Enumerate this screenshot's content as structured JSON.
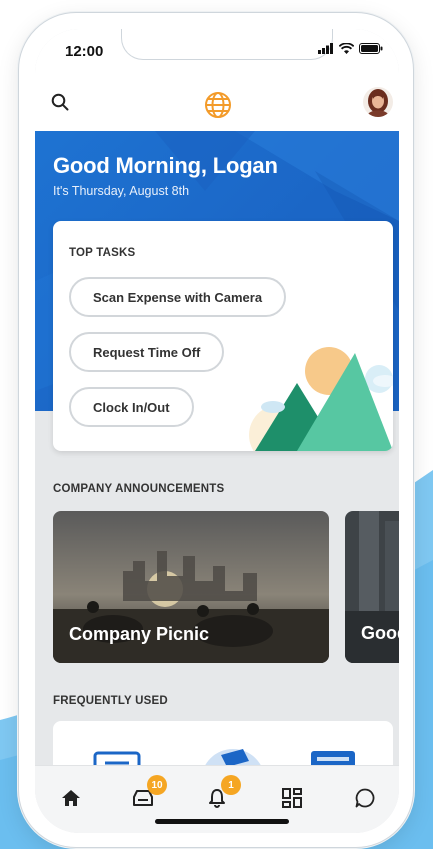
{
  "status_bar": {
    "time": "12:00"
  },
  "app_bar": {
    "search_icon": "search-icon",
    "logo_icon": "globe-icon",
    "avatar": "user-avatar"
  },
  "hero": {
    "greeting": "Good Morning, Logan",
    "date": "It's Thursday, August 8th"
  },
  "top_tasks": {
    "title": "TOP TASKS",
    "buttons": [
      {
        "label": "Scan Expense with Camera"
      },
      {
        "label": "Request Time Off"
      },
      {
        "label": "Clock In/Out"
      }
    ]
  },
  "announcements": {
    "title": "COMPANY ANNOUNCEMENTS",
    "cards": [
      {
        "title": "Company Picnic"
      },
      {
        "title": "Good People"
      }
    ]
  },
  "frequently_used": {
    "title": "FREQUENTLY USED"
  },
  "tab_bar": {
    "items": [
      {
        "icon": "home-icon"
      },
      {
        "icon": "inbox-icon",
        "badge": "10"
      },
      {
        "icon": "bell-icon",
        "badge": "1"
      },
      {
        "icon": "apps-icon"
      },
      {
        "icon": "chat-icon"
      }
    ]
  },
  "colors": {
    "primary_blue": "#1b66c6",
    "badge_orange": "#f5a623",
    "mountain_green": "#2bb38a"
  }
}
